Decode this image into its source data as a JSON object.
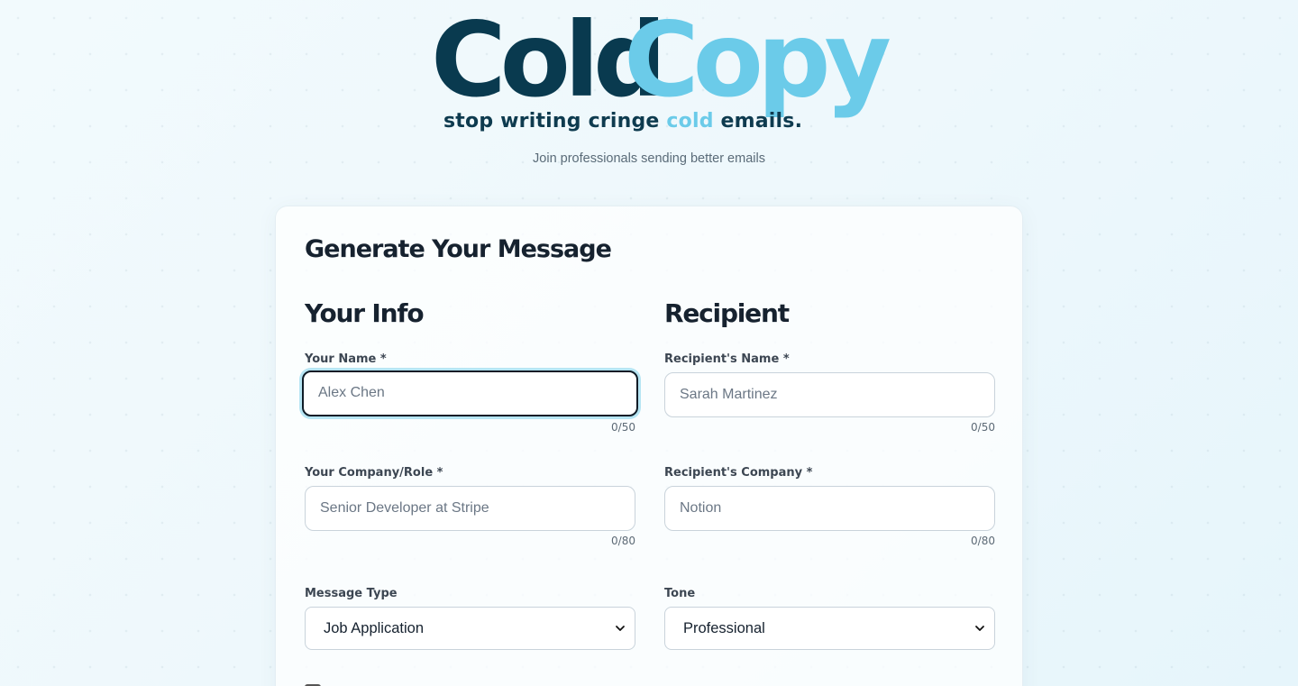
{
  "brand": {
    "logo_part1": "Cold",
    "logo_part2": "Copy",
    "tagline_before": "stop writing cringe ",
    "tagline_accent": "cold",
    "tagline_after": " emails.",
    "subtitle": "Join professionals sending better emails"
  },
  "colors": {
    "dark_teal": "#093a4f",
    "light_blue": "#6bcbe9",
    "focus_ring": "#0f1b26"
  },
  "form": {
    "title": "Generate Your Message",
    "your_info": {
      "heading": "Your Info",
      "name_label": "Your Name *",
      "name_placeholder": "Alex Chen",
      "name_counter": "0/50",
      "company_label": "Your Company/Role *",
      "company_placeholder": "Senior Developer at Stripe",
      "company_counter": "0/80",
      "message_type_label": "Message Type",
      "message_type_value": "Job Application"
    },
    "recipient": {
      "heading": "Recipient",
      "name_label": "Recipient's Name *",
      "name_placeholder": "Sarah Martinez",
      "name_counter": "0/50",
      "company_label": "Recipient's Company *",
      "company_placeholder": "Notion",
      "company_counter": "0/80",
      "tone_label": "Tone",
      "tone_value": "Professional"
    }
  },
  "icons": {
    "select_arrow": "chevron-down-icon"
  }
}
